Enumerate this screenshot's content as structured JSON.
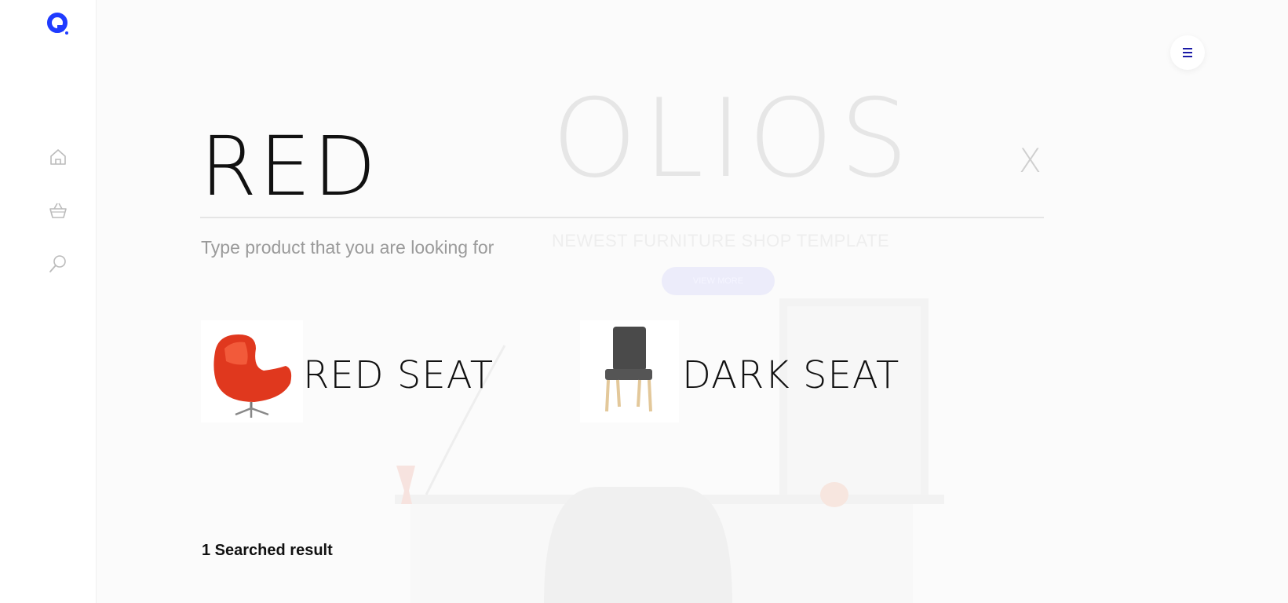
{
  "hero": {
    "title": "OLIOS",
    "subtitle": "NEWEST FURNITURE SHOP TEMPLATE",
    "cta_label": "VIEW MORE"
  },
  "sidebar": {
    "items": [
      {
        "icon": "home-icon"
      },
      {
        "icon": "basket-icon"
      },
      {
        "icon": "search-icon"
      }
    ]
  },
  "search": {
    "value": "RED",
    "hint": "Type product that you are looking for",
    "close_label": "X",
    "results": [
      {
        "name": "RED SEAT",
        "image": "red-egg-chair"
      },
      {
        "name": "DARK SEAT",
        "image": "dark-grey-chair"
      }
    ],
    "count_text": "1 Searched result"
  },
  "colors": {
    "brand": "#1a1aa6",
    "logo": "#1f3bff"
  }
}
